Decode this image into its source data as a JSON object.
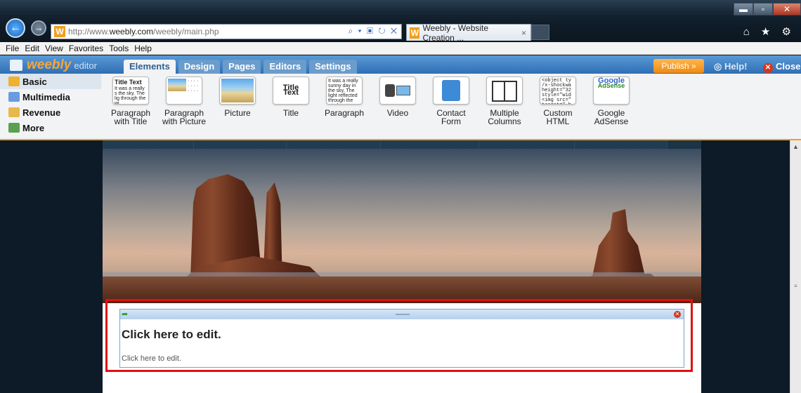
{
  "browser": {
    "url_prefix": "http://www.",
    "url_domain": "weebly.com",
    "url_path": "/weebly/main.php",
    "tab_title": "Weebly - Website Creation ...",
    "tab_close": "×",
    "address_icons": "⌕ ▾ ▣ ↻ ✕",
    "back": "←",
    "forward": "→",
    "chrome_icons": "⌂ ★ ⚙",
    "window": {
      "minimize": "▬",
      "maximize": "▫",
      "close": "✕"
    },
    "menu": [
      "File",
      "Edit",
      "View",
      "Favorites",
      "Tools",
      "Help"
    ]
  },
  "editor": {
    "brand": "weebly",
    "brand_sub": "editor",
    "tabs": [
      {
        "label": "Elements",
        "active": true
      },
      {
        "label": "Design"
      },
      {
        "label": "Pages"
      },
      {
        "label": "Editors"
      },
      {
        "label": "Settings"
      }
    ],
    "publish": "Publish »",
    "help": "Help!",
    "close": "Close",
    "categories": [
      {
        "label": "Basic",
        "icon": "basic-icon",
        "color": "#f0b030"
      },
      {
        "label": "Multimedia",
        "icon": "multimedia-icon",
        "color": "#6a9be0"
      },
      {
        "label": "Revenue",
        "icon": "revenue-icon",
        "color": "#e7b84a"
      },
      {
        "label": "More",
        "icon": "more-icon",
        "color": "#5aa050"
      }
    ],
    "elements": [
      {
        "label1": "Paragraph",
        "label2": "with Title",
        "thumb_title": "Title Text",
        "thumb_text": "It was a really s the sky. The lig through the wi"
      },
      {
        "label1": "Paragraph",
        "label2": "with Picture"
      },
      {
        "label1": "Picture",
        "label2": ""
      },
      {
        "label1": "Title",
        "label2": "",
        "thumb_title": "Title Text"
      },
      {
        "label1": "Paragraph",
        "label2": "",
        "thumb_text": "It was a really sunny day in the sky. The light reflected through the window."
      },
      {
        "label1": "Video",
        "label2": ""
      },
      {
        "label1": "Contact",
        "label2": "Form"
      },
      {
        "label1": "Multiple",
        "label2": "Columns"
      },
      {
        "label1": "Custom",
        "label2": "HTML",
        "thumb_code": "<object ty /x-shockwa height=\"32 style=\"wid <img src=\" target=\"_b"
      },
      {
        "label1": "Google",
        "label2": "AdSense",
        "thumb_title": "Google",
        "thumb_text": "AdSense"
      }
    ]
  },
  "page": {
    "edit_title": "Click here to edit.",
    "edit_body": "Click here to edit."
  }
}
